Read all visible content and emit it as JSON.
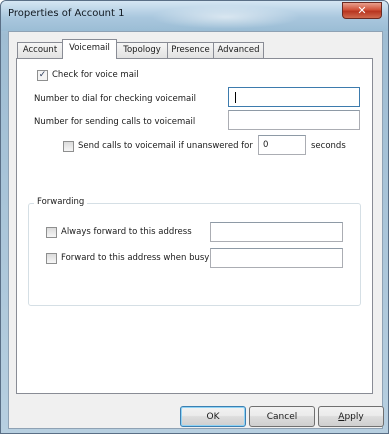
{
  "window": {
    "title": "Properties of Account 1",
    "close_symbol": "✕"
  },
  "tabs": [
    {
      "label": "Account"
    },
    {
      "label": "Voicemail"
    },
    {
      "label": "Topology"
    },
    {
      "label": "Presence"
    },
    {
      "label": "Advanced"
    }
  ],
  "active_tab": "Voicemail",
  "voicemail": {
    "check_voicemail": {
      "label": "Check for voice mail",
      "checked": true
    },
    "dial_number": {
      "label": "Number to dial for checking voicemail",
      "value": ""
    },
    "send_number": {
      "label": "Number for sending calls to voicemail",
      "value": ""
    },
    "unanswered": {
      "label": "Send calls to voicemail if unanswered for",
      "checked": false,
      "seconds_value": "0",
      "unit_label": "seconds"
    }
  },
  "forwarding": {
    "legend": "Forwarding",
    "always": {
      "label": "Always forward to this address",
      "checked": false,
      "value": ""
    },
    "busy": {
      "label": "Forward to this address when busy",
      "checked": false,
      "value": ""
    }
  },
  "buttons": {
    "ok": "OK",
    "cancel": "Cancel",
    "apply_prefix": "A",
    "apply_rest": "pply"
  },
  "colors": {
    "title_bar": "#a9c7de",
    "close": "#c8452e",
    "focus_border": "#3d7bad"
  }
}
